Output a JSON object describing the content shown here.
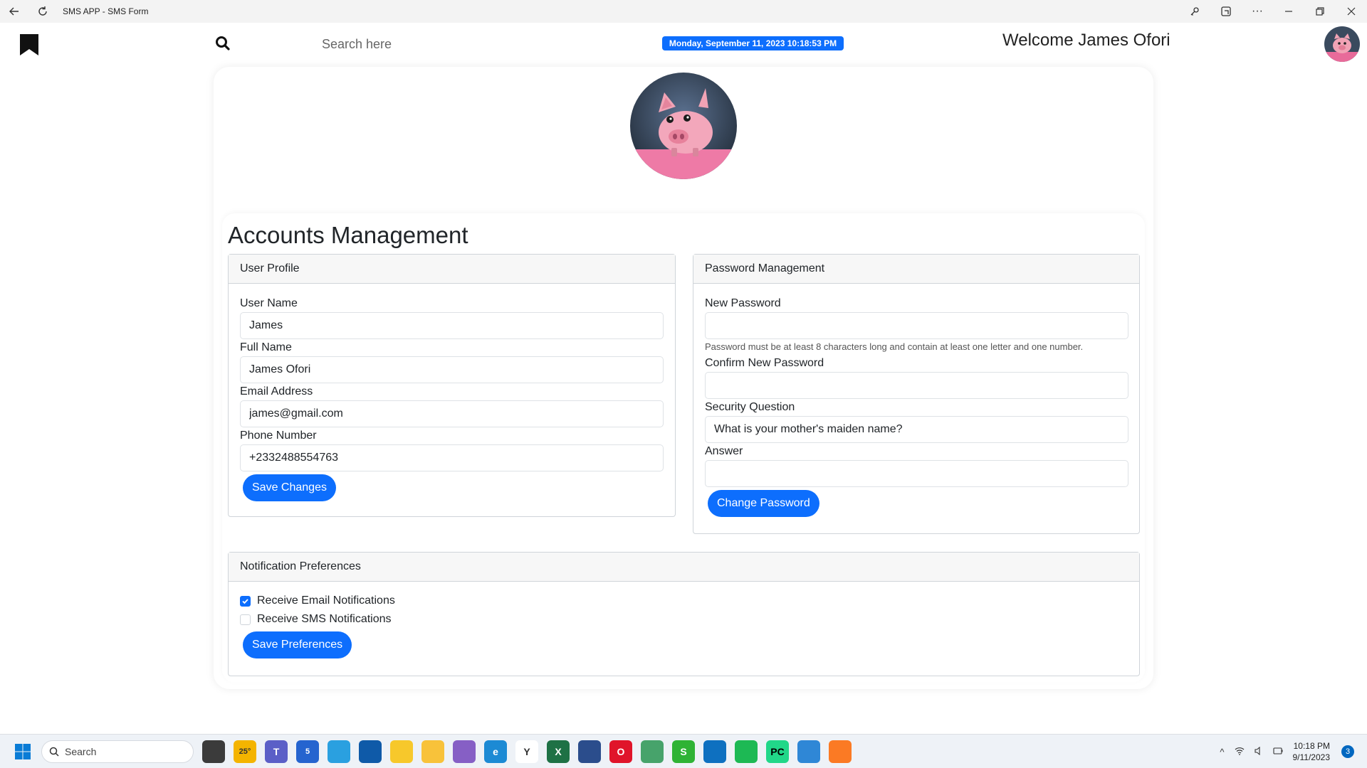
{
  "window": {
    "title": "SMS APP - SMS Form"
  },
  "header": {
    "search_placeholder": "Search here",
    "datetime": "Monday, September 11, 2023 10:18:53 PM",
    "welcome": "Welcome James Ofori"
  },
  "page": {
    "title": "Accounts Management"
  },
  "profile": {
    "heading": "User Profile",
    "username_label": "User Name",
    "username_value": "James",
    "fullname_label": "Full Name",
    "fullname_value": "James Ofori",
    "email_label": "Email Address",
    "email_value": "james@gmail.com",
    "phone_label": "Phone Number",
    "phone_value": "+2332488554763",
    "save_button": "Save Changes"
  },
  "password": {
    "heading": "Password Management",
    "new_label": "New Password",
    "new_value": "",
    "hint": "Password must be at least 8 characters long and contain at least one letter and one number.",
    "confirm_label": "Confirm New Password",
    "confirm_value": "",
    "question_label": "Security Question",
    "question_value": "What is your mother's maiden name?",
    "answer_label": "Answer",
    "answer_value": "",
    "change_button": "Change Password"
  },
  "notifications": {
    "heading": "Notification Preferences",
    "email_label": "Receive Email Notifications",
    "email_checked": true,
    "sms_label": "Receive SMS Notifications",
    "sms_checked": false,
    "save_button": "Save Preferences"
  },
  "taskbar": {
    "search_label": "Search",
    "weather": "25°",
    "store_badge": "5",
    "time": "10:18 PM",
    "date": "9/11/2023",
    "notification_count": "3",
    "icons": [
      "widgets-icon",
      "file-explorer-small-icon",
      "weather-icon",
      "teams-icon",
      "todo-icon",
      "notebook-icon",
      "store-icon",
      "paint-icon",
      "folder-icon",
      "visual-studio-icon",
      "edge-icon",
      "yarn-icon",
      "excel-icon",
      "app-icon",
      "opera-icon",
      "media-icon",
      "s-app-icon",
      "vscode-icon",
      "spotify-icon",
      "pycharm-icon",
      "snipping-icon",
      "xampp-icon"
    ]
  },
  "colors": {
    "primary": "#0d6efd",
    "header_bg": "#f7f7f7",
    "border": "#cfd4d9"
  }
}
